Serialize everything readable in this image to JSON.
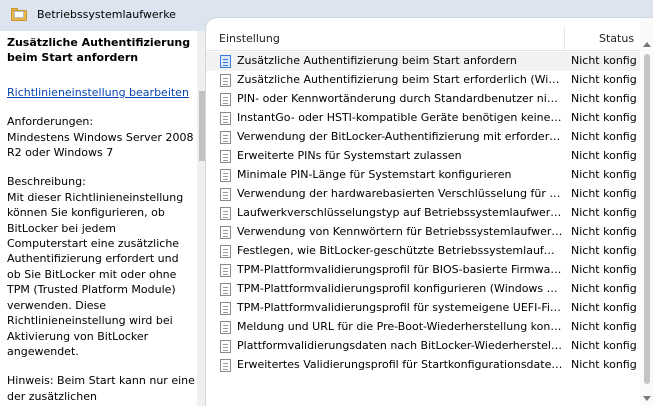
{
  "header": {
    "title": "Betriebssystemlaufwerke"
  },
  "description": {
    "title": "Zusätzliche Authentifizierung beim Start anfordern",
    "edit_link": "Richtlinieneinstellung bearbeiten",
    "requirements_label": "Anforderungen:",
    "requirements_text": "Mindestens Windows Server 2008 R2 oder Windows 7",
    "description_label": "Beschreibung:",
    "description_text": "Mit dieser Richtlinieneinstellung können Sie konfigurieren, ob BitLocker bei jedem Computerstart eine zusätzliche Authentifizierung erfordert und ob Sie BitLocker mit oder ohne TPM (Trusted Platform Module) verwenden. Diese Richtlinieneinstellung wird bei Aktivierung von BitLocker angewendet.",
    "hint_text": "Hinweis: Beim Start kann nur eine der zusätzlichen Authentifizierungsoptionen"
  },
  "list": {
    "col_name": "Einstellung",
    "col_status": "Status",
    "rows": [
      {
        "name": "Zusätzliche Authentifizierung beim Start anfordern",
        "status": "Nicht konfig"
      },
      {
        "name": "Zusätzliche Authentifizierung beim Start erforderlich (Windo...",
        "status": "Nicht konfig"
      },
      {
        "name": "PIN- oder Kennwortänderung durch Standardbenutzer nicht...",
        "status": "Nicht konfig"
      },
      {
        "name": "InstantGo- oder HSTI-kompatible Geräte benötigen keine Pl...",
        "status": "Nicht konfig"
      },
      {
        "name": "Verwendung der BitLocker-Authentifizierung mit erforderlic...",
        "status": "Nicht konfig"
      },
      {
        "name": "Erweiterte PINs für Systemstart zulassen",
        "status": "Nicht konfig"
      },
      {
        "name": "Minimale PIN-Länge für Systemstart konfigurieren",
        "status": "Nicht konfig"
      },
      {
        "name": "Verwendung der hardwarebasierten Verschlüsselung für Betr...",
        "status": "Nicht konfig"
      },
      {
        "name": "Laufwerkverschlüsselungstyp auf Betriebssystemlaufwerken ...",
        "status": "Nicht konfig"
      },
      {
        "name": "Verwendung von Kennwörtern für Betriebssystemlaufwerke ...",
        "status": "Nicht konfig"
      },
      {
        "name": "Festlegen, wie BitLocker-geschützte Betriebssystemlaufwerk...",
        "status": "Nicht konfig"
      },
      {
        "name": "TPM-Plattformvalidierungsprofil für BIOS-basierte Firmware...",
        "status": "Nicht konfig"
      },
      {
        "name": "TPM-Plattformvalidierungsprofil konfigurieren (Windows Vi...",
        "status": "Nicht konfig"
      },
      {
        "name": "TPM-Plattformvalidierungsprofil für systemeigene UEFI-Fir...",
        "status": "Nicht konfig"
      },
      {
        "name": "Meldung und URL für die Pre-Boot-Wiederherstellung konfi...",
        "status": "Nicht konfig"
      },
      {
        "name": "Plattformvalidierungsdaten nach BitLocker-Wiederherstell...",
        "status": "Nicht konfig"
      },
      {
        "name": "Erweitertes Validierungsprofil für Startkonfigurationsdaten v...",
        "status": "Nicht konfig"
      }
    ]
  },
  "icons": {
    "folder": "policy-folder-icon",
    "setting": "policy-setting-icon"
  }
}
